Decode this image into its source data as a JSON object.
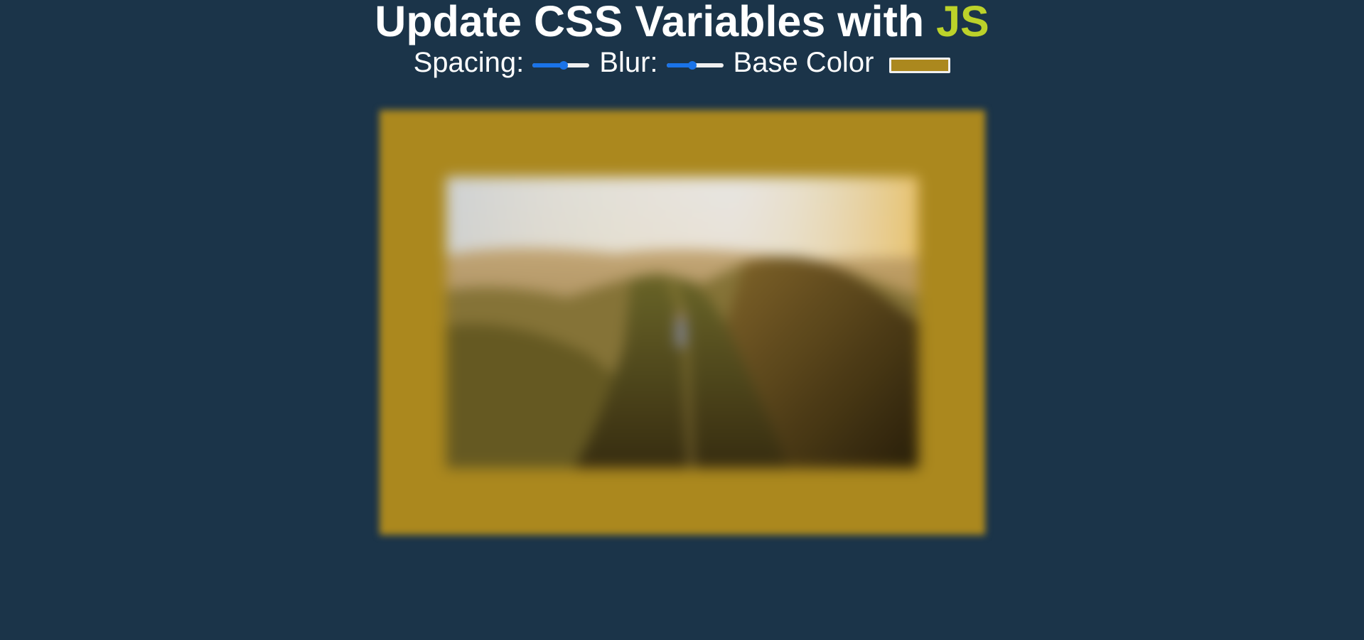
{
  "heading": {
    "text": "Update CSS Variables with ",
    "highlight": "JS",
    "highlight_color": "#bcd22a"
  },
  "controls": {
    "spacing": {
      "label": "Spacing:",
      "value": 0.55
    },
    "blur": {
      "label": "Blur:",
      "value": 0.45
    },
    "base_color": {
      "label": "Base Color",
      "value": "#ab881e"
    }
  },
  "image": {
    "icon": "mountain-ridge-photo"
  },
  "colors": {
    "background": "#1b3449",
    "slider_accent": "#1a73e8"
  }
}
